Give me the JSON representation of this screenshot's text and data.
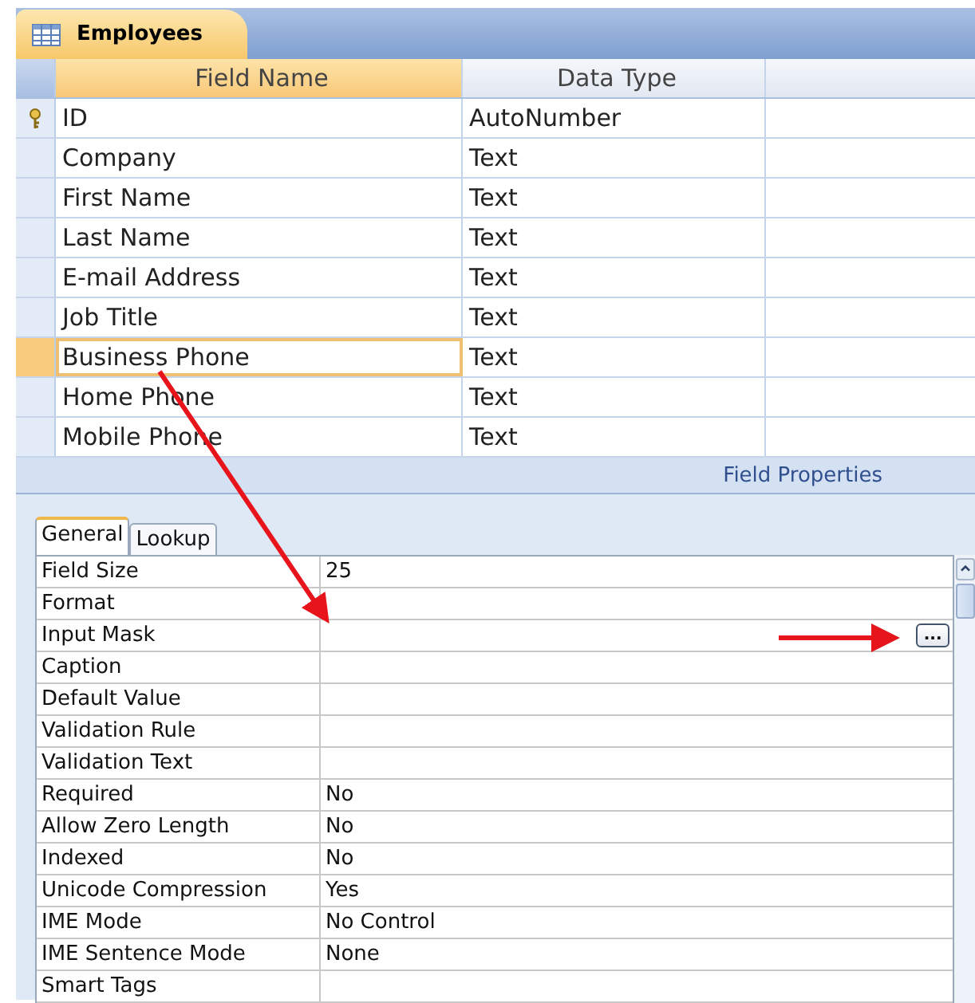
{
  "document_tab": {
    "title": "Employees"
  },
  "columns": [
    "Field Name",
    "Data Type"
  ],
  "rows": [
    {
      "field_name": "ID",
      "data_type": "AutoNumber",
      "primary_key": true,
      "selected": false
    },
    {
      "field_name": "Company",
      "data_type": "Text",
      "primary_key": false,
      "selected": false
    },
    {
      "field_name": "First Name",
      "data_type": "Text",
      "primary_key": false,
      "selected": false
    },
    {
      "field_name": "Last Name",
      "data_type": "Text",
      "primary_key": false,
      "selected": false
    },
    {
      "field_name": "E-mail Address",
      "data_type": "Text",
      "primary_key": false,
      "selected": false
    },
    {
      "field_name": "Job Title",
      "data_type": "Text",
      "primary_key": false,
      "selected": false
    },
    {
      "field_name": "Business Phone",
      "data_type": "Text",
      "primary_key": false,
      "selected": true
    },
    {
      "field_name": "Home Phone",
      "data_type": "Text",
      "primary_key": false,
      "selected": false
    },
    {
      "field_name": "Mobile Phone",
      "data_type": "Text",
      "primary_key": false,
      "selected": false
    }
  ],
  "field_properties": {
    "title": "Field Properties",
    "tabs": [
      {
        "label": "General",
        "selected": true
      },
      {
        "label": "Lookup",
        "selected": false
      }
    ],
    "properties": [
      {
        "label": "Field Size",
        "value": "25"
      },
      {
        "label": "Format"
      },
      {
        "label": "Input Mask",
        "builder_button": "..."
      },
      {
        "label": "Caption"
      },
      {
        "label": "Default Value"
      },
      {
        "label": "Validation Rule"
      },
      {
        "label": "Validation Text"
      },
      {
        "label": "Required",
        "value": "No"
      },
      {
        "label": "Allow Zero Length",
        "value": "No"
      },
      {
        "label": "Indexed",
        "value": "No"
      },
      {
        "label": "Unicode Compression",
        "value": "Yes"
      },
      {
        "label": "IME Mode",
        "value": "No Control"
      },
      {
        "label": "IME Sentence Mode",
        "value": "None"
      },
      {
        "label": "Smart Tags"
      }
    ]
  }
}
